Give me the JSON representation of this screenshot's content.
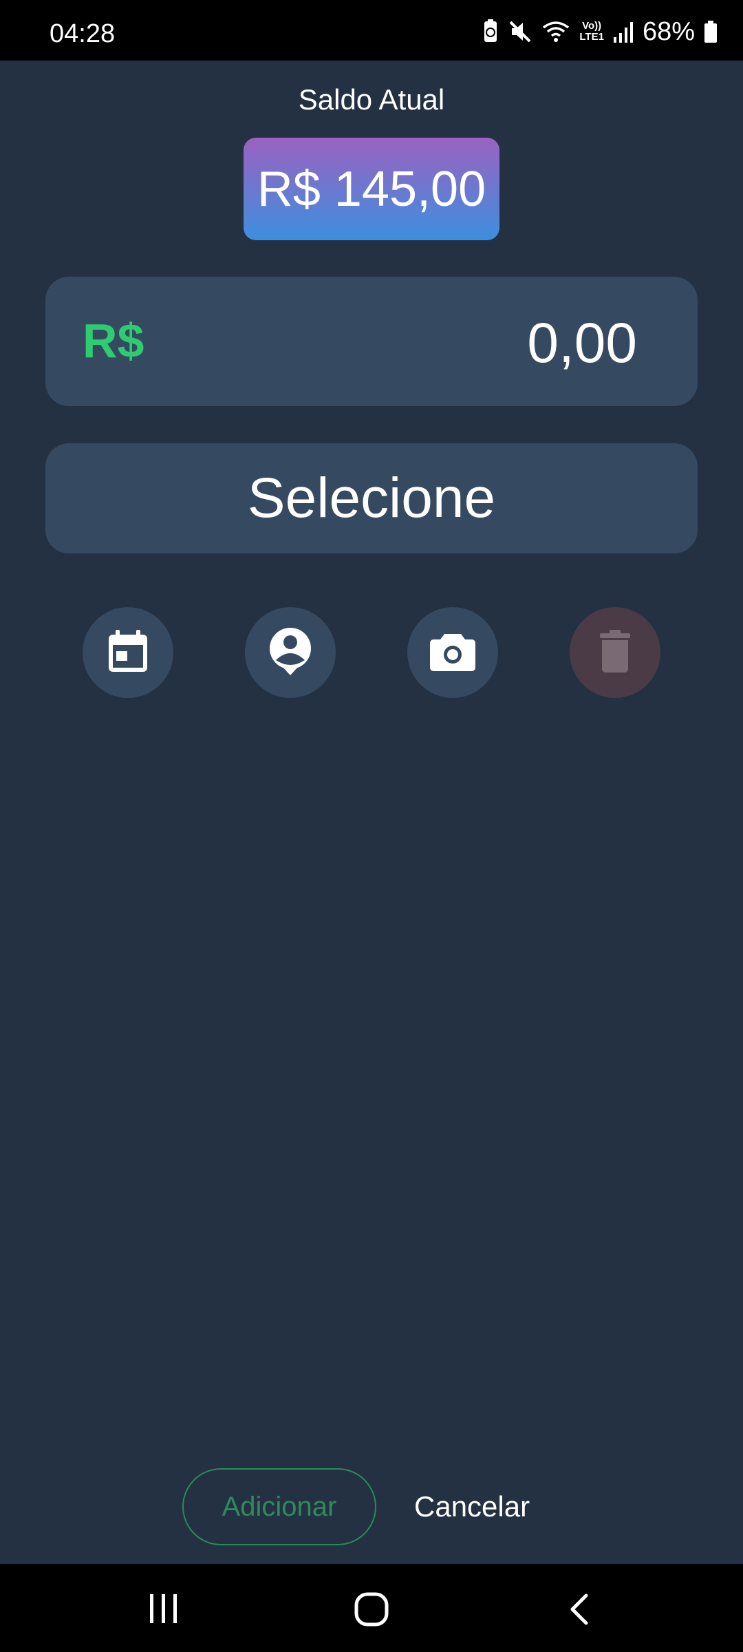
{
  "status_bar": {
    "time": "04:28",
    "lte_line1": "Vo))",
    "lte_line2": "LTE1",
    "battery": "68%",
    "icons": [
      "battery-saver-icon",
      "mute-icon",
      "wifi-icon",
      "volte-icon",
      "signal-icon",
      "battery-icon"
    ]
  },
  "header": {
    "label": "Saldo Atual",
    "balance": "R$ 145,00"
  },
  "amount": {
    "currency": "R$",
    "value": "0,00"
  },
  "category": {
    "placeholder": "Selecione"
  },
  "actions": {
    "icons": [
      "calendar-icon",
      "person-pin-icon",
      "camera-icon",
      "trash-icon"
    ]
  },
  "footer": {
    "add_label": "Adicionar",
    "cancel_label": "Cancelar"
  },
  "nav": {
    "icons": [
      "recent-apps-icon",
      "home-icon",
      "back-icon"
    ]
  },
  "colors": {
    "background": "#233142",
    "card": "#354960",
    "accent_green": "#2ecc71",
    "gradient_top": "#9a62c0",
    "gradient_bottom": "#3d8fdf"
  }
}
